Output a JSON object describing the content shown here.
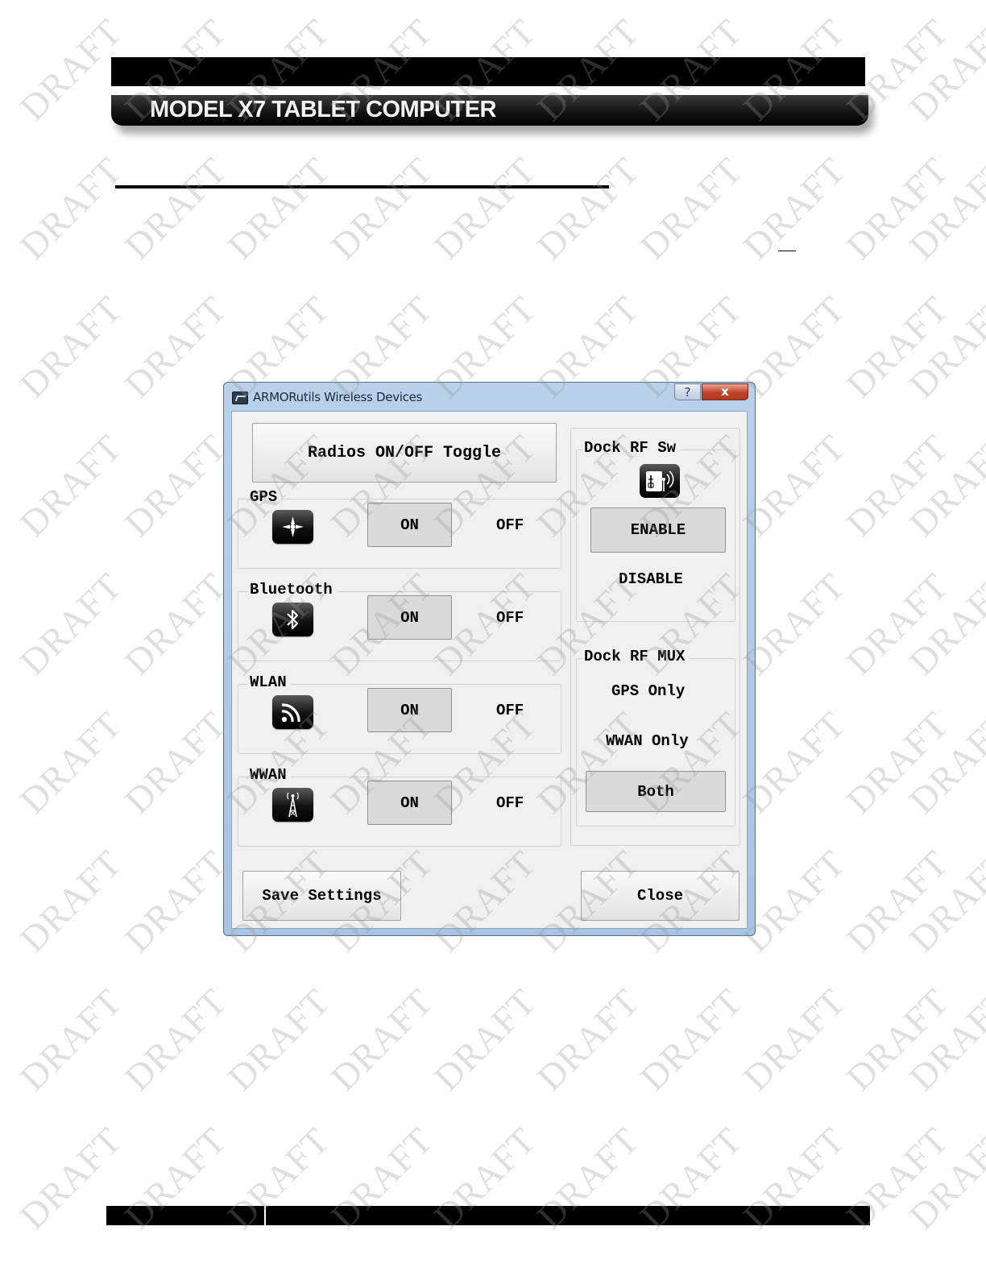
{
  "document": {
    "title": "MODEL X7 TABLET COMPUTER",
    "watermark": "DRAFT"
  },
  "dialog": {
    "title": "ARMORutils Wireless Devices",
    "help_glyph": "?",
    "close_glyph": "x",
    "radios_toggle": "Radios ON/OFF Toggle",
    "on_label": "ON",
    "off_label": "OFF",
    "devices": [
      {
        "name": "GPS",
        "icon": "gps-icon",
        "state": "ON"
      },
      {
        "name": "Bluetooth",
        "icon": "bluetooth-icon",
        "state": "ON"
      },
      {
        "name": "WLAN",
        "icon": "wlan-icon",
        "state": "ON"
      },
      {
        "name": "WWAN",
        "icon": "wwan-icon",
        "state": "ON"
      }
    ],
    "dock_rf_sw": {
      "label": "Dock RF Sw",
      "icon": "dock-antenna-icon",
      "enable": "ENABLE",
      "disable": "DISABLE",
      "selected": "ENABLE"
    },
    "dock_rf_mux": {
      "label": "Dock RF MUX",
      "options": [
        "GPS Only",
        "WWAN Only",
        "Both"
      ],
      "selected": "Both"
    },
    "save_settings": "Save Settings",
    "close": "Close"
  }
}
